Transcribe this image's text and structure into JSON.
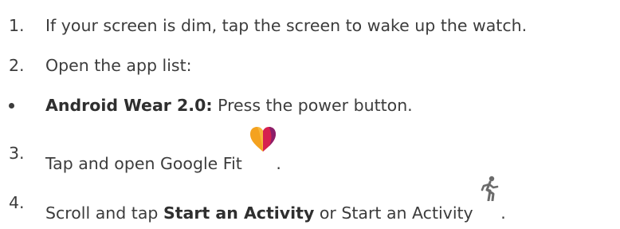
{
  "steps": [
    {
      "number": "1.",
      "text": "If your screen is dim, tap the screen to wake up the watch."
    },
    {
      "number": "2.",
      "text": "Open the app list:"
    },
    {
      "bold": "Android Wear 2.0:",
      "text": " Press the power button."
    },
    {
      "number": "3.",
      "text": "Tap and open Google Fit",
      "icon": "google-fit-heart-icon",
      "after": "."
    },
    {
      "number": "4.",
      "pre": "Scroll and tap ",
      "bold": "Start an Activity",
      "mid": " or Start an Activity ",
      "icon": "running-person-icon",
      "after": "."
    }
  ],
  "colors": {
    "text": "#3c3c3c",
    "heart_left": "#f4a21f",
    "heart_right": "#d6204f",
    "heart_far_right": "#8b1f6a"
  }
}
